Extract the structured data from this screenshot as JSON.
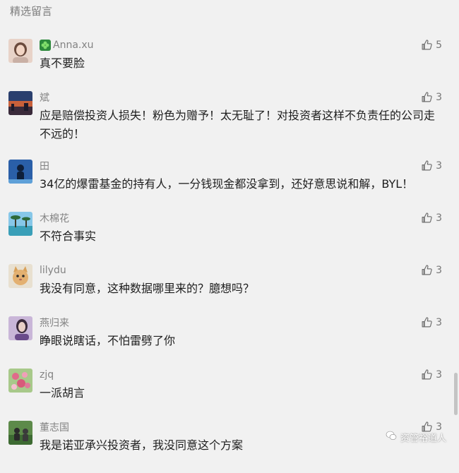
{
  "section_title": "精选留言",
  "comments": [
    {
      "name": "Anna.xu",
      "text": "真不要脸",
      "likes": "5",
      "avatar_icon": "woman-portrait-avatar",
      "badge_icon": "clover-badge-icon"
    },
    {
      "name": "斌",
      "text": "应是赔偿投资人损失！粉色为赠予！太无耻了！对投资者这样不负责任的公司走不远的！",
      "likes": "3",
      "avatar_icon": "sunset-landscape-avatar"
    },
    {
      "name": "田",
      "text": "34亿的爆雷基金的持有人，一分钱现金都没拿到，还好意思说和解，BYL！",
      "likes": "3",
      "avatar_icon": "blue-figure-avatar"
    },
    {
      "name": "木棉花",
      "text": "不符合事实",
      "likes": "3",
      "avatar_icon": "beach-palm-avatar"
    },
    {
      "name": "lilydu",
      "text": "我没有同意，这种数据哪里来的？臆想吗？",
      "likes": "3",
      "avatar_icon": "cat-avatar"
    },
    {
      "name": "燕归来",
      "text": "睁眼说瞎话，不怕雷劈了你",
      "likes": "3",
      "avatar_icon": "purple-portrait-avatar"
    },
    {
      "name": "zjq",
      "text": "一派胡言",
      "likes": "3",
      "avatar_icon": "flowers-avatar"
    },
    {
      "name": "董志国",
      "text": "我是诺亚承兴投资者，我没同意这个方案",
      "likes": "3",
      "avatar_icon": "green-photo-avatar"
    }
  ],
  "watermark": {
    "text": "资管裕道人",
    "icon": "wechat-icon"
  },
  "colors": {
    "background": "#f1f1f1",
    "name": "#838383",
    "text": "#1e1e1e"
  }
}
